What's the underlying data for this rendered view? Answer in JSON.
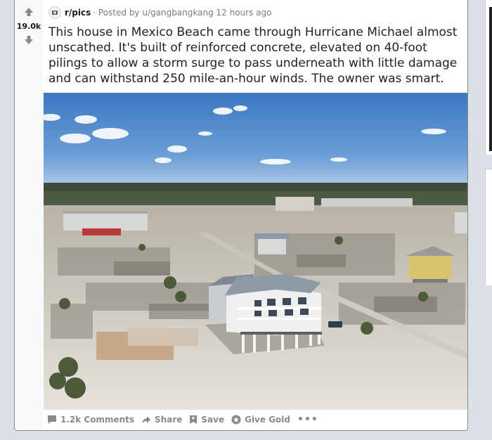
{
  "post": {
    "score": "19.0k",
    "subreddit": "r/pics",
    "posted_by": "· Posted by u/gangbangkang 12 hours ago",
    "title": "This house in Mexico Beach came through Hurricane Michael almost unscathed. It's built of reinforced concrete, elevated on 40-foot pilings to allow a storm surge to pass underneath with little damage and can withstand 250 mile-an-hour winds. The owner was smart."
  },
  "actions": {
    "comments": "1.2k Comments",
    "share": "Share",
    "save": "Save",
    "give_gold": "Give Gold",
    "more": "•••"
  },
  "colors": {
    "background": "#dae0e6",
    "vote_column": "#f8f9fa",
    "muted_text": "#878a8c",
    "title_text": "#222222"
  },
  "icons": [
    "upvote-icon",
    "downvote-icon",
    "comment-icon",
    "share-icon",
    "save-icon",
    "gold-icon",
    "more-icon"
  ]
}
